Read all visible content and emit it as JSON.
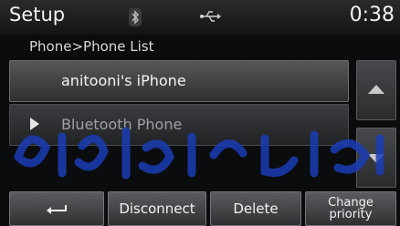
{
  "status_bar": {
    "title": "Setup",
    "bluetooth_icon": "bluetooth-icon",
    "usb_icon": "usb-icon",
    "time": "0:38"
  },
  "breadcrumb": "Phone>Phone List",
  "phone_list": {
    "items": [
      {
        "label": "anitooni's iPhone",
        "selected": true
      },
      {
        "label": "Bluetooth Phone",
        "connected": true,
        "icon": "play-icon"
      }
    ]
  },
  "scroll": {
    "up_icon": "scroll-up-icon",
    "down_icon": "scroll-down-icon"
  },
  "bottom_bar": {
    "back_icon": "back-arrow-icon",
    "disconnect_label": "Disconnect",
    "delete_label": "Delete",
    "change_priority_line1": "Change",
    "change_priority_line2": "priority"
  },
  "colors": {
    "accent_watermark": "#1b3db5",
    "background": "#0b0c0e"
  }
}
